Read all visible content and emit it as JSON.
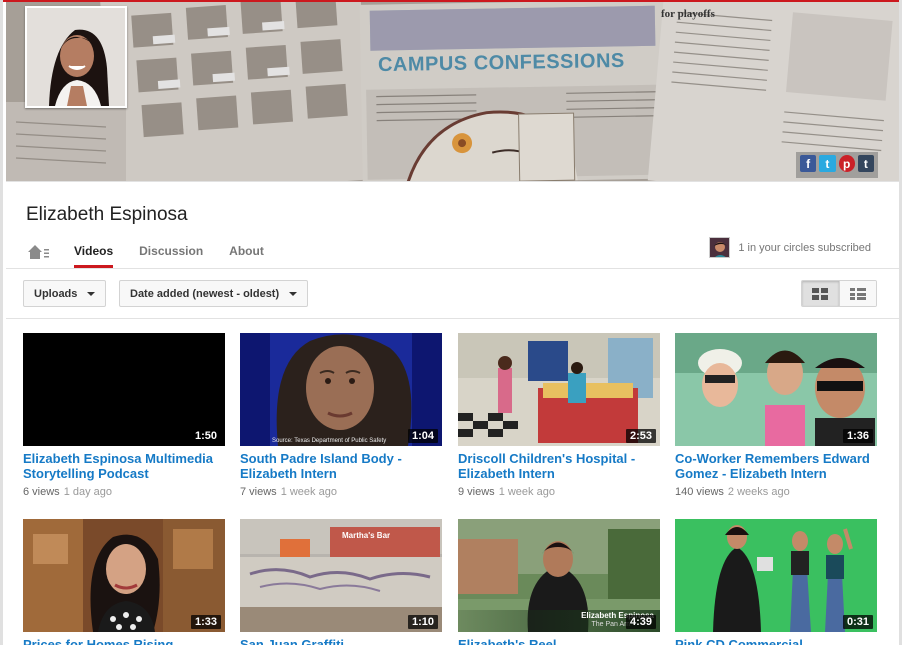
{
  "channel": {
    "name": "Elizabeth Espinosa",
    "banner_text": "CAMPUS CONFESSIONS",
    "banner_small_text": "for playoffs"
  },
  "tabs": [
    {
      "label": "Videos",
      "active": true
    },
    {
      "label": "Discussion",
      "active": false
    },
    {
      "label": "About",
      "active": false
    }
  ],
  "subscription": {
    "text": "1 in your circles subscribed"
  },
  "toolbar": {
    "uploads_label": "Uploads",
    "sort_label": "Date added (newest - oldest)"
  },
  "social": [
    "f",
    "t",
    "p",
    "t"
  ],
  "videos": [
    {
      "title": "Elizabeth Espinosa Multimedia Storytelling Podcast",
      "duration": "1:50",
      "views": "6 views",
      "age": "1 day ago"
    },
    {
      "title": "South Padre Island Body - Elizabeth Intern",
      "duration": "1:04",
      "views": "7 views",
      "age": "1 week ago",
      "caption": "Source: Texas Department of Public Safety"
    },
    {
      "title": "Driscoll Children's Hospital - Elizabeth Intern",
      "duration": "2:53",
      "views": "9 views",
      "age": "1 week ago"
    },
    {
      "title": "Co-Worker Remembers Edward Gomez - Elizabeth Intern",
      "duration": "1:36",
      "views": "140 views",
      "age": "2 weeks ago"
    },
    {
      "title": "Prices for Homes Rising",
      "duration": "1:33",
      "views": "",
      "age": ""
    },
    {
      "title": "San Juan Graffiti",
      "duration": "1:10",
      "views": "",
      "age": "",
      "sign": "Martha's Bar"
    },
    {
      "title": "Elizabeth's Reel",
      "duration": "4:39",
      "views": "",
      "age": "",
      "lower_third": "Elizabeth Espinosa",
      "lower_third_sub": "The Pan Am"
    },
    {
      "title": "Pink CD Commercial",
      "duration": "0:31",
      "views": "",
      "age": ""
    }
  ],
  "colors": {
    "accent": "#cc181e",
    "link": "#167ac6"
  }
}
